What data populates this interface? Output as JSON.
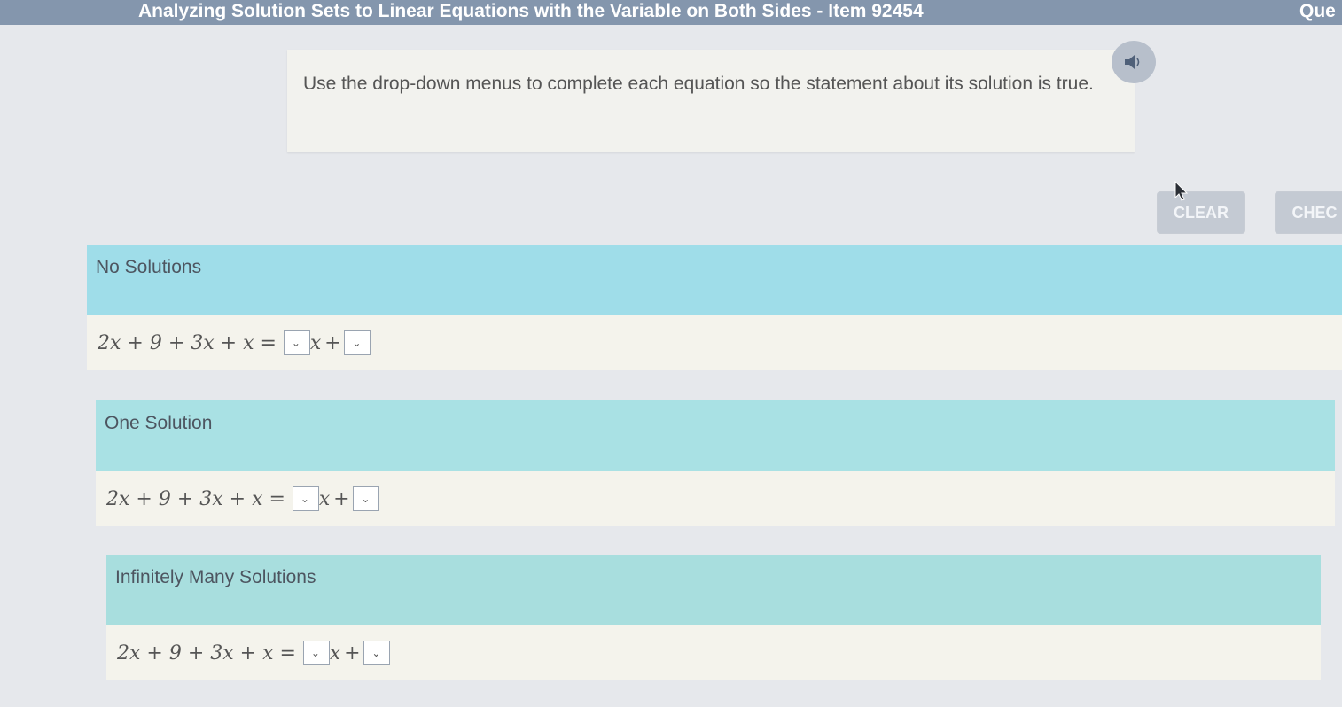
{
  "header": {
    "title": "Analyzing Solution Sets to Linear Equations with the Variable on Both Sides - Item 92454",
    "right_label": "Que"
  },
  "instructions": {
    "text": "Use the drop-down menus to complete each equation so the statement about its solution is true."
  },
  "toolbar": {
    "clear_label": "CLEAR",
    "check_label": "CHEC"
  },
  "sections": [
    {
      "label": "No Solutions",
      "equation_left": "2x + 9 + 3x + x =",
      "var": "x",
      "plus": "+"
    },
    {
      "label": "One Solution",
      "equation_left": "2x + 9 + 3x + x =",
      "var": "x",
      "plus": "+"
    },
    {
      "label": "Infinitely Many Solutions",
      "equation_left": "2x + 9 + 3x + x =",
      "var": "x",
      "plus": "+"
    }
  ],
  "icons": {
    "audio": "speaker-icon",
    "dropdown": "chevron-down-icon",
    "cursor": "mouse-cursor-icon"
  },
  "colors": {
    "header_bg": "#8496ad",
    "section_header_bg": "#9fdde9",
    "section_body_bg": "#f4f3ec"
  }
}
